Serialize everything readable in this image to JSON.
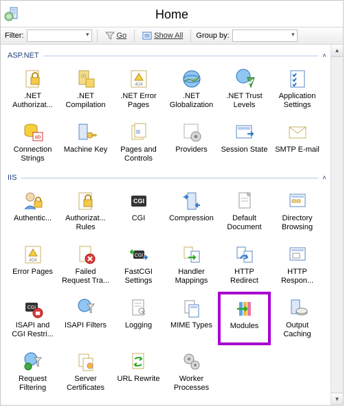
{
  "header": {
    "title": "Home"
  },
  "toolbar": {
    "filter_label": "Filter:",
    "filter_value": "",
    "go_label": "Go",
    "showall_label": "Show All",
    "groupby_label": "Group by:",
    "groupby_value": ""
  },
  "groups": [
    {
      "name": "ASP.NET",
      "items": [
        {
          "id": "net-auth",
          "label": ".NET Authorizat...",
          "icon": "lock-doc"
        },
        {
          "id": "net-comp",
          "label": ".NET Compilation",
          "icon": "bin-cube"
        },
        {
          "id": "net-err",
          "label": ".NET Error Pages",
          "icon": "err-404"
        },
        {
          "id": "net-glob",
          "label": ".NET Globalization",
          "icon": "globe"
        },
        {
          "id": "net-trust",
          "label": ".NET Trust Levels",
          "icon": "shield-check"
        },
        {
          "id": "app-set",
          "label": "Application Settings",
          "icon": "checklist"
        },
        {
          "id": "conn-str",
          "label": "Connection Strings",
          "icon": "db-ab"
        },
        {
          "id": "mach-key",
          "label": "Machine Key",
          "icon": "server-key"
        },
        {
          "id": "pages-ctrl",
          "label": "Pages and Controls",
          "icon": "pages"
        },
        {
          "id": "providers",
          "label": "Providers",
          "icon": "provider-gear"
        },
        {
          "id": "session",
          "label": "Session State",
          "icon": "session"
        },
        {
          "id": "smtp",
          "label": "SMTP E-mail",
          "icon": "envelope"
        }
      ]
    },
    {
      "name": "IIS",
      "items": [
        {
          "id": "authn",
          "label": "Authentic...",
          "icon": "user-lock"
        },
        {
          "id": "authz",
          "label": "Authorizat... Rules",
          "icon": "lock-doc"
        },
        {
          "id": "cgi",
          "label": "CGI",
          "icon": "cgi"
        },
        {
          "id": "compress",
          "label": "Compression",
          "icon": "compress"
        },
        {
          "id": "def-doc",
          "label": "Default Document",
          "icon": "doc"
        },
        {
          "id": "dir-browse",
          "label": "Directory Browsing",
          "icon": "dir-browse"
        },
        {
          "id": "err-pages",
          "label": "Error Pages",
          "icon": "err-404"
        },
        {
          "id": "failed-req",
          "label": "Failed Request Tra...",
          "icon": "doc-x"
        },
        {
          "id": "fastcgi",
          "label": "FastCGI Settings",
          "icon": "cgi-arrows"
        },
        {
          "id": "hmap",
          "label": "Handler Mappings",
          "icon": "hmap"
        },
        {
          "id": "http-redir",
          "label": "HTTP Redirect",
          "icon": "redirect"
        },
        {
          "id": "http-resp",
          "label": "HTTP Respon...",
          "icon": "http-resp"
        },
        {
          "id": "isapi-cgi",
          "label": "ISAPI and CGI Restri...",
          "icon": "cgi-lock"
        },
        {
          "id": "isapi-fil",
          "label": "ISAPI Filters",
          "icon": "filter"
        },
        {
          "id": "logging",
          "label": "Logging",
          "icon": "log"
        },
        {
          "id": "mime",
          "label": "MIME Types",
          "icon": "mime"
        },
        {
          "id": "modules",
          "label": "Modules",
          "icon": "modules",
          "highlighted": true
        },
        {
          "id": "out-cache",
          "label": "Output Caching",
          "icon": "server-disk"
        },
        {
          "id": "req-filter",
          "label": "Request Filtering",
          "icon": "req-filter"
        },
        {
          "id": "srv-cert",
          "label": "Server Certificates",
          "icon": "cert"
        },
        {
          "id": "url-rw",
          "label": "URL Rewrite",
          "icon": "url-rw"
        },
        {
          "id": "wproc",
          "label": "Worker Processes",
          "icon": "gears"
        }
      ]
    }
  ]
}
